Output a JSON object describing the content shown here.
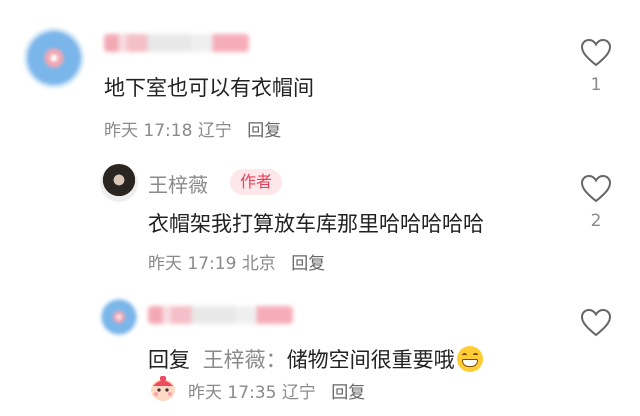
{
  "comments": [
    {
      "text": "地下室也可以有衣帽间",
      "time": "昨天 17:18",
      "location": "辽宁",
      "reply_label": "回复",
      "likes": "1"
    },
    {
      "username": "王梓薇",
      "author_badge": "作者",
      "text": "衣帽架我打算放车库那里哈哈哈哈哈",
      "time": "昨天 17:19",
      "location": "北京",
      "reply_label": "回复",
      "likes": "2"
    },
    {
      "reply_prefix": "回复",
      "reply_target": "王梓薇：",
      "text": "储物空间很重要哦",
      "time": "昨天 17:35",
      "location": "辽宁",
      "reply_label": "回复"
    }
  ],
  "colors": {
    "accent": "#e8405b",
    "meta": "#8a8a8a",
    "text": "#222222"
  },
  "icons": {
    "like": "heart-outline-icon",
    "emoji": "grinning-face-emoji",
    "user_badge": "cartoon-badge-icon"
  }
}
